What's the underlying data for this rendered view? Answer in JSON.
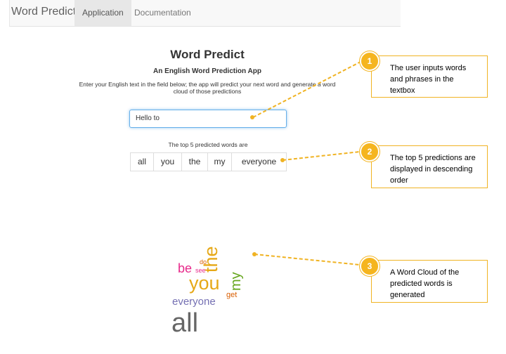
{
  "navbar": {
    "brand": "Word Predict",
    "tabs": [
      {
        "label": "Application",
        "active": true
      },
      {
        "label": "Documentation",
        "active": false
      }
    ]
  },
  "app": {
    "title": "Word Predict",
    "subtitle": "An English Word Prediction App",
    "instructions": "Enter your English text in the field below; the app will predict your next word and generate a word cloud of those predictions",
    "input_value": "Hello to",
    "predictions_label": "The top 5 predicted words are",
    "predictions": [
      "all",
      "you",
      "the",
      "my",
      "everyone"
    ]
  },
  "word_cloud": {
    "words": [
      {
        "text": "the",
        "color": "#e6a817"
      },
      {
        "text": "be",
        "color": "#e7298a"
      },
      {
        "text": "do",
        "color": "#d95f02"
      },
      {
        "text": "see",
        "color": "#e7298a"
      },
      {
        "text": "you",
        "color": "#e6a817"
      },
      {
        "text": "my",
        "color": "#66a61e"
      },
      {
        "text": "get",
        "color": "#d95f02"
      },
      {
        "text": "everyone",
        "color": "#7570b3"
      },
      {
        "text": "all",
        "color": "#666666"
      }
    ]
  },
  "callouts": [
    {
      "number": "1",
      "text": "The user inputs words and phrases in the textbox"
    },
    {
      "number": "2",
      "text": "The top 5 predictions are displayed in descending order"
    },
    {
      "number": "3",
      "text": "A Word Cloud of the predicted words is generated"
    }
  ],
  "colors": {
    "accent": "#f5b51f",
    "input_focus": "#66afe9"
  }
}
